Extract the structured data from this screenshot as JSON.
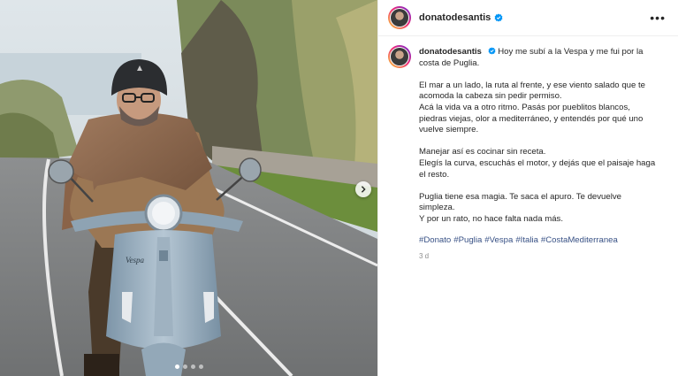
{
  "post": {
    "username": "donatodesantis",
    "caption_intro": "Hoy me subí a la Vespa y me fui por la costa de Puglia.",
    "paragraphs": [
      [
        "El mar a un lado, la ruta al frente, y ese viento salado que te acomoda la cabeza sin pedir permiso.",
        "Acá la vida va a otro ritmo. Pasás por pueblitos blancos, piedras viejas, olor a mediterráneo, y entendés por qué uno vuelve siempre."
      ],
      [
        "Manejar así es cocinar sin receta.",
        "Elegís la curva, escuchás el motor, y dejás que el paisaje haga el resto."
      ],
      [
        "Puglia tiene esa magia. Te saca el apuro. Te devuelve simpleza.",
        "Y por un rato, no hace falta nada más."
      ]
    ],
    "hashtags": [
      "#Donato",
      "#Puglia",
      "#Vespa",
      "#Italia",
      "#CostaMediterranea"
    ],
    "time_ago": "3 d",
    "scooter_brand": "Vespa",
    "carousel_total": 4,
    "carousel_active": 1
  },
  "icons": {
    "verified": "verified-badge-icon",
    "more": "more-options-icon",
    "next": "chevron-right-icon"
  },
  "colors": {
    "verified": "#0095f6",
    "hashtag": "#385185",
    "time": "#8e8e8e"
  }
}
